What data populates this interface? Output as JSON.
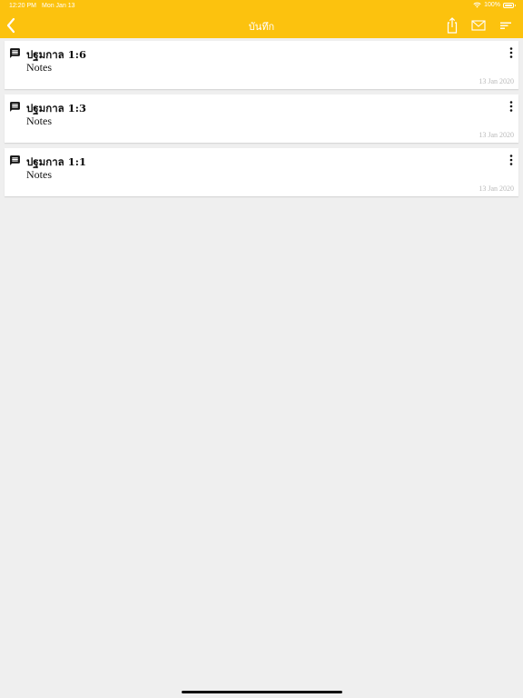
{
  "status_bar": {
    "time": "12:20 PM",
    "date": "Mon Jan 13",
    "battery": "100%"
  },
  "nav": {
    "title": "บันทึก",
    "back_icon": "chevron-left-icon",
    "actions": [
      "share-icon",
      "mail-icon",
      "sort-icon"
    ]
  },
  "notes": [
    {
      "title": "ปฐมกาล 1:6",
      "body": "Notes",
      "date": "13 Jan 2020"
    },
    {
      "title": "ปฐมกาล 1:3",
      "body": "Notes",
      "date": "13 Jan 2020"
    },
    {
      "title": "ปฐมกาล 1:1",
      "body": "Notes",
      "date": "13 Jan 2020"
    }
  ],
  "colors": {
    "accent": "#fcc20e",
    "background": "#efefef",
    "card": "#ffffff",
    "date_text": "#b9b9b9"
  }
}
